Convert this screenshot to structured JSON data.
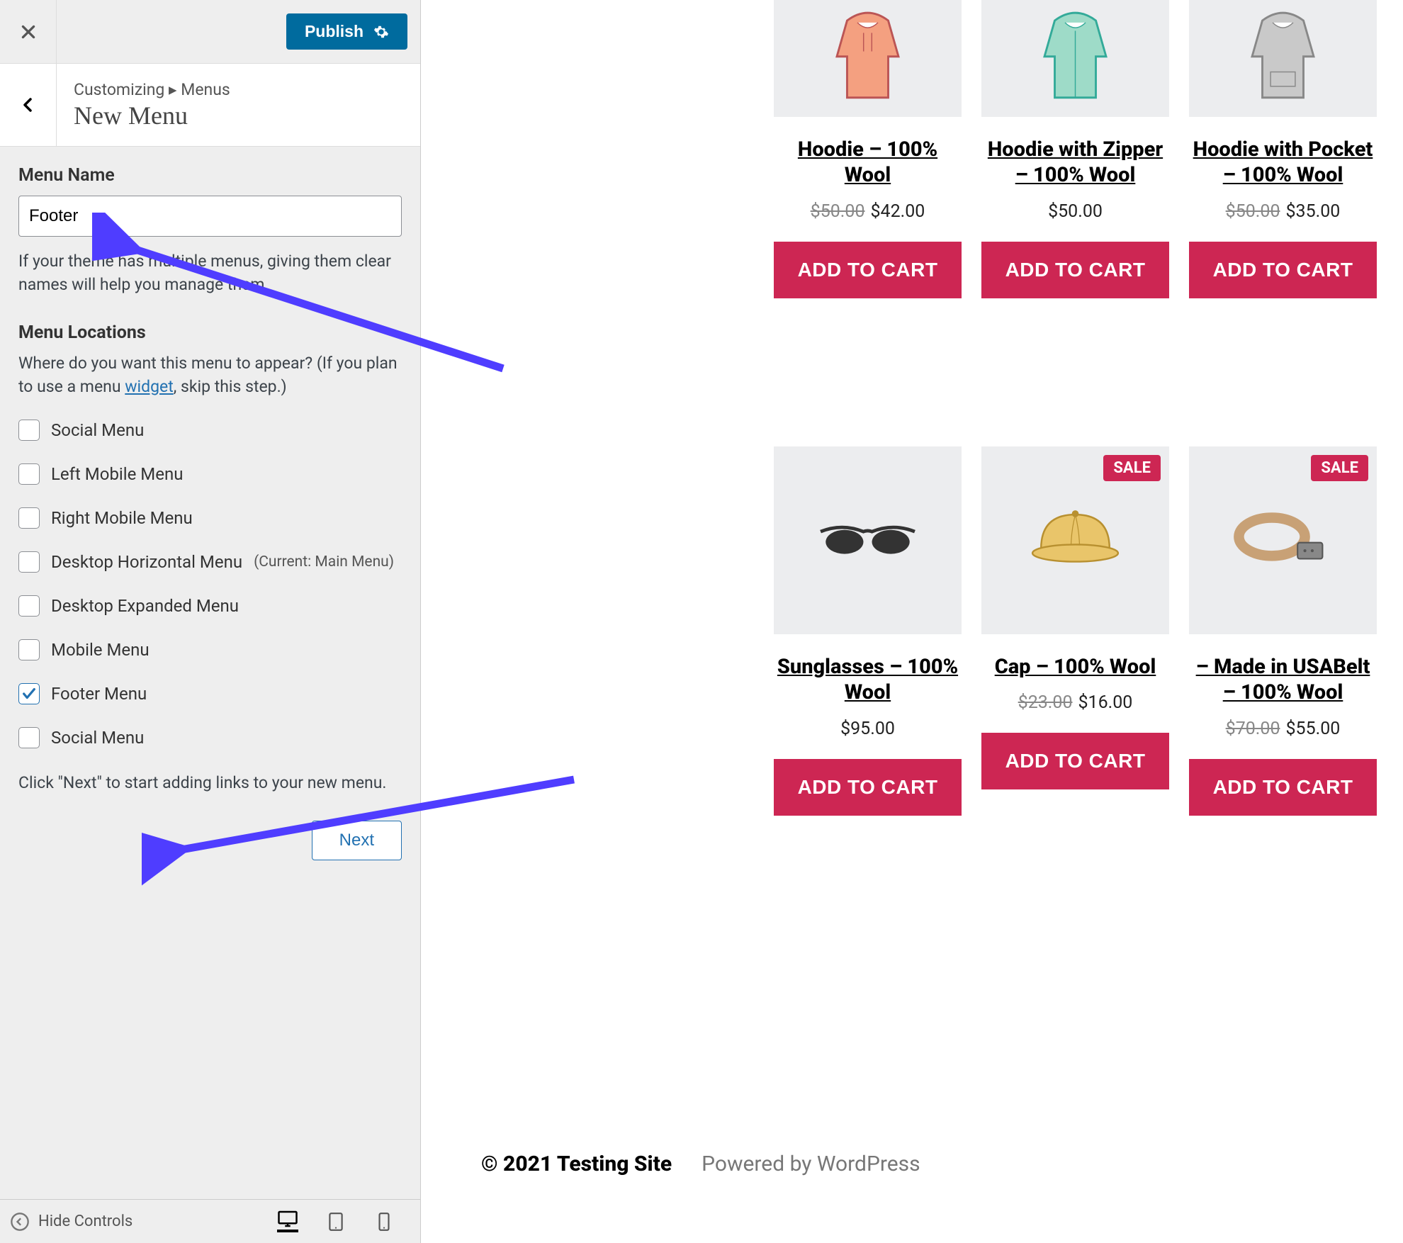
{
  "customizer": {
    "publish_label": "Publish",
    "breadcrumb_prefix": "Customizing ▸ Menus",
    "breadcrumb_title": "New Menu",
    "menu_name_label": "Menu Name",
    "menu_name_value": "Footer",
    "menu_name_help": "If your theme has multiple menus, giving them clear names will help you manage them.",
    "locations_heading": "Menu Locations",
    "locations_help_a": "Where do you want this menu to appear? (If you plan to use a menu ",
    "locations_help_link": "widget",
    "locations_help_b": ", skip this step.)",
    "checks": [
      {
        "label": "Social Menu",
        "checked": false,
        "suffix": ""
      },
      {
        "label": "Left Mobile Menu",
        "checked": false,
        "suffix": ""
      },
      {
        "label": "Right Mobile Menu",
        "checked": false,
        "suffix": ""
      },
      {
        "label": "Desktop Horizontal Menu",
        "checked": false,
        "suffix": "(Current: Main Menu)"
      },
      {
        "label": "Desktop Expanded Menu",
        "checked": false,
        "suffix": ""
      },
      {
        "label": "Mobile Menu",
        "checked": false,
        "suffix": ""
      },
      {
        "label": "Footer Menu",
        "checked": true,
        "suffix": ""
      },
      {
        "label": "Social Menu",
        "checked": false,
        "suffix": ""
      }
    ],
    "next_help": "Click \"Next\" to start adding links to your new menu.",
    "next_label": "Next",
    "hide_controls_label": "Hide Controls"
  },
  "preview": {
    "products_row1": [
      {
        "name": "Hoodie – 100% Wool",
        "old": "$50.00",
        "price": "$42.00",
        "sale": false,
        "icon": "hoodie-orange"
      },
      {
        "name": "Hoodie with Zipper – 100% Wool",
        "old": "",
        "price": "$50.00",
        "sale": false,
        "icon": "hoodie-teal"
      },
      {
        "name": "Hoodie with Pocket – 100% Wool",
        "old": "$50.00",
        "price": "$35.00",
        "sale": false,
        "icon": "hoodie-gray"
      }
    ],
    "products_row2": [
      {
        "name": "Sunglasses – 100% Wool",
        "old": "",
        "price": "$95.00",
        "sale": false,
        "icon": "sunglasses"
      },
      {
        "name": "Cap – 100% Wool",
        "old": "$23.00",
        "price": "$16.00",
        "sale": true,
        "icon": "cap"
      },
      {
        "name": "– Made in USABelt – 100% Wool",
        "old": "$70.00",
        "price": "$55.00",
        "sale": true,
        "icon": "belt"
      }
    ],
    "sale_label": "SALE",
    "atc_label": "ADD TO CART",
    "copyright": "© 2021 Testing Site",
    "powered": "Powered by WordPress"
  }
}
